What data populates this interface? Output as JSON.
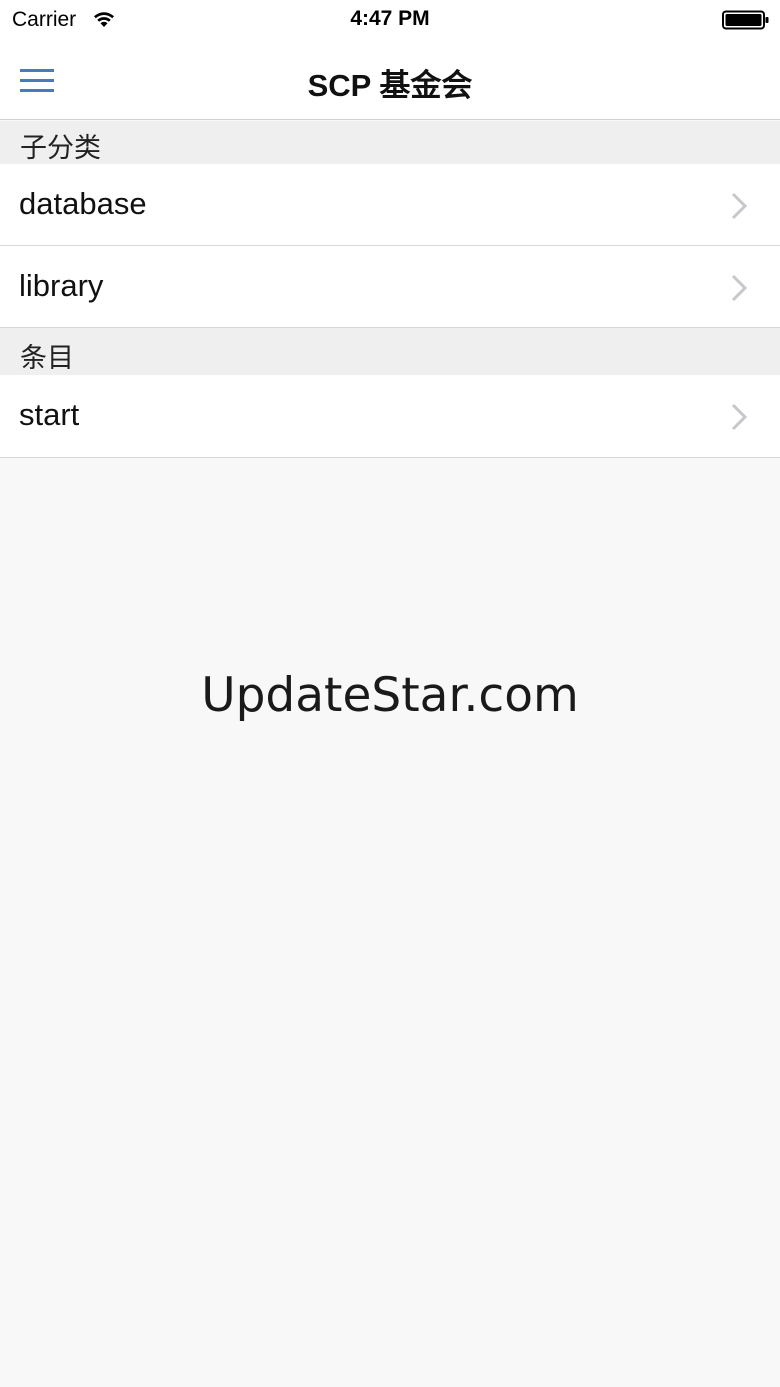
{
  "status_bar": {
    "carrier": "Carrier",
    "time": "4:47 PM",
    "icons": [
      "wifi-icon",
      "battery-icon"
    ]
  },
  "nav": {
    "title": "SCP 基金会",
    "menu_icon": "hamburger-menu-icon",
    "accent_color": "#4a7ab8"
  },
  "sections": [
    {
      "header": "子分类",
      "items": [
        {
          "label": "database"
        },
        {
          "label": "library"
        }
      ]
    },
    {
      "header": "条目",
      "items": [
        {
          "label": "start"
        }
      ]
    }
  ],
  "watermark": "UpdateStar.com"
}
